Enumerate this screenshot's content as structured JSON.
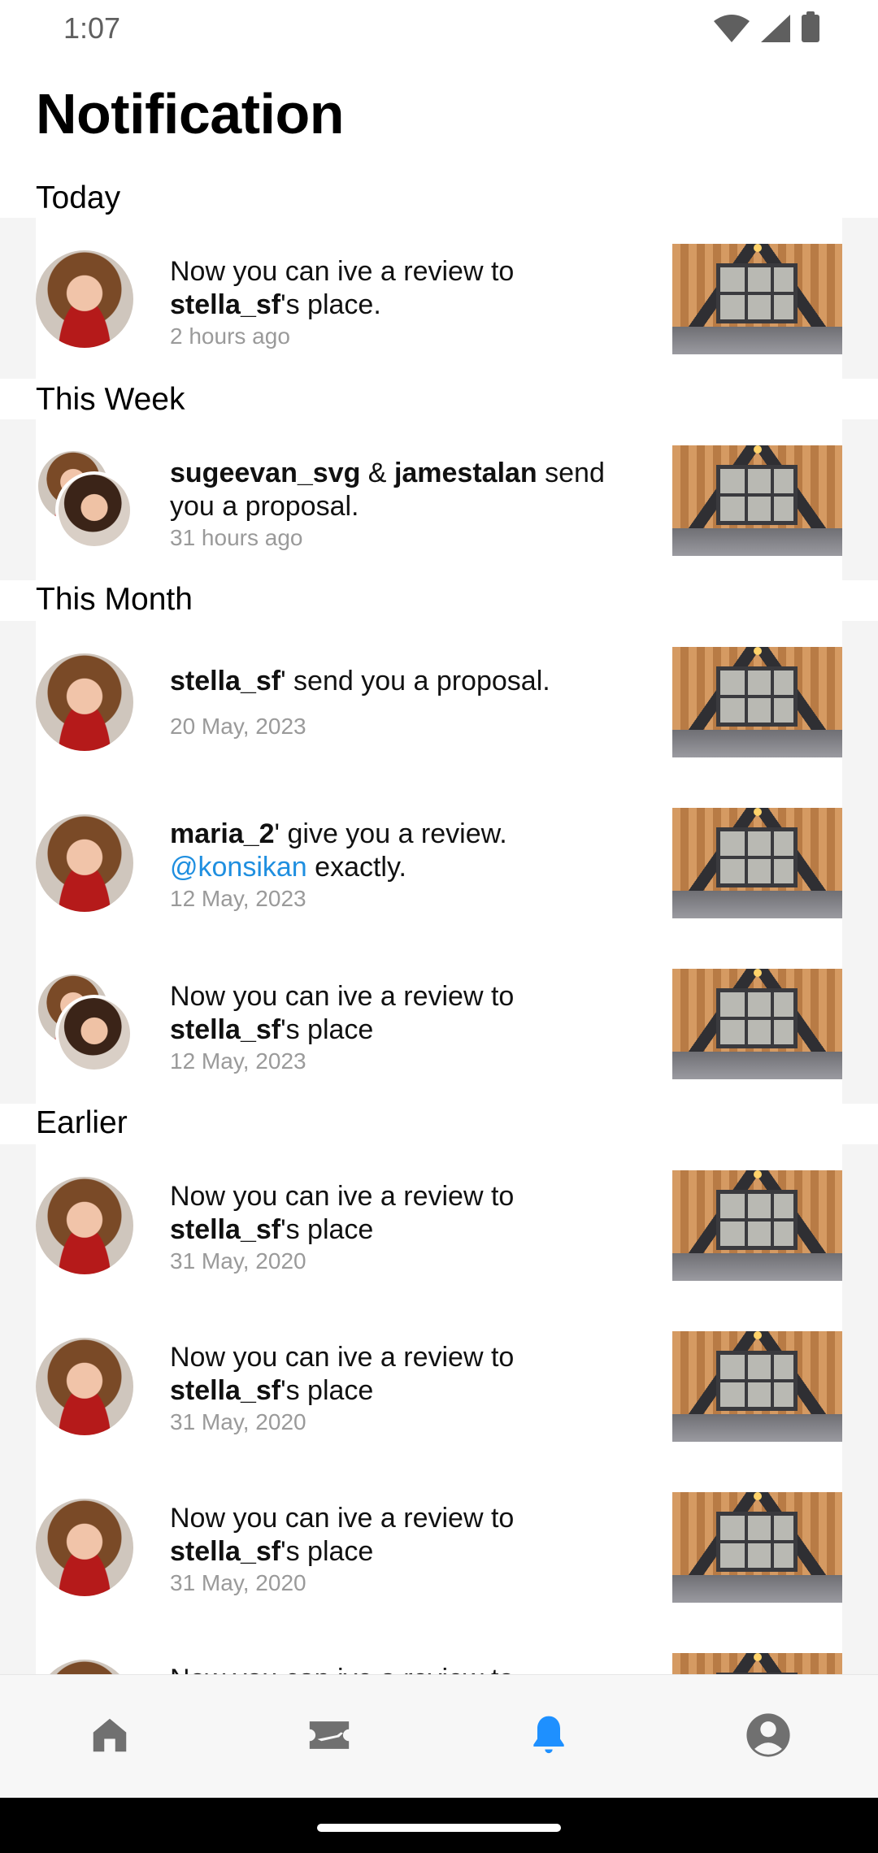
{
  "status_bar": {
    "time": "1:07"
  },
  "page_title": "Notification",
  "sections": {
    "today": "Today",
    "this_week": "This Week",
    "this_month": "This Month",
    "earlier": "Earlier"
  },
  "items": [
    {
      "pre": "Now you can ive a review to ",
      "user": "stella_sf",
      "post": "'s place.",
      "time": "2 hours ago"
    },
    {
      "user1": "sugeevan_svg",
      "amp": " & ",
      "user2": "jamestalan",
      "post": " send you a proposal.",
      "time": "31 hours ago"
    },
    {
      "user": "stella_sf",
      "post": "' send you a proposal.",
      "time": "20 May, 2023"
    },
    {
      "user": "maria_2",
      "post": "' give you a review.",
      "mention": "@konsikan",
      "post2": " exactly.",
      "time": "12 May, 2023"
    },
    {
      "pre": "Now you can ive a review to ",
      "user": "stella_sf",
      "post": "'s place",
      "time": "12 May, 2023"
    },
    {
      "pre": "Now you can ive a review to ",
      "user": "stella_sf",
      "post": "'s place",
      "time": "31 May, 2020"
    },
    {
      "pre": "Now you can ive a review to ",
      "user": "stella_sf",
      "post": "'s place",
      "time": "31 May, 2020"
    },
    {
      "pre": "Now you can ive a review to ",
      "user": "stella_sf",
      "post": "'s place",
      "time": "31 May, 2020"
    },
    {
      "pre": "Now you can ive a review to"
    }
  ],
  "nav": {
    "items": [
      "home-icon",
      "ticket-icon",
      "bell-icon",
      "account-icon"
    ],
    "active": "bell-icon",
    "active_color": "#1e90ff",
    "inactive_color": "#707070"
  }
}
